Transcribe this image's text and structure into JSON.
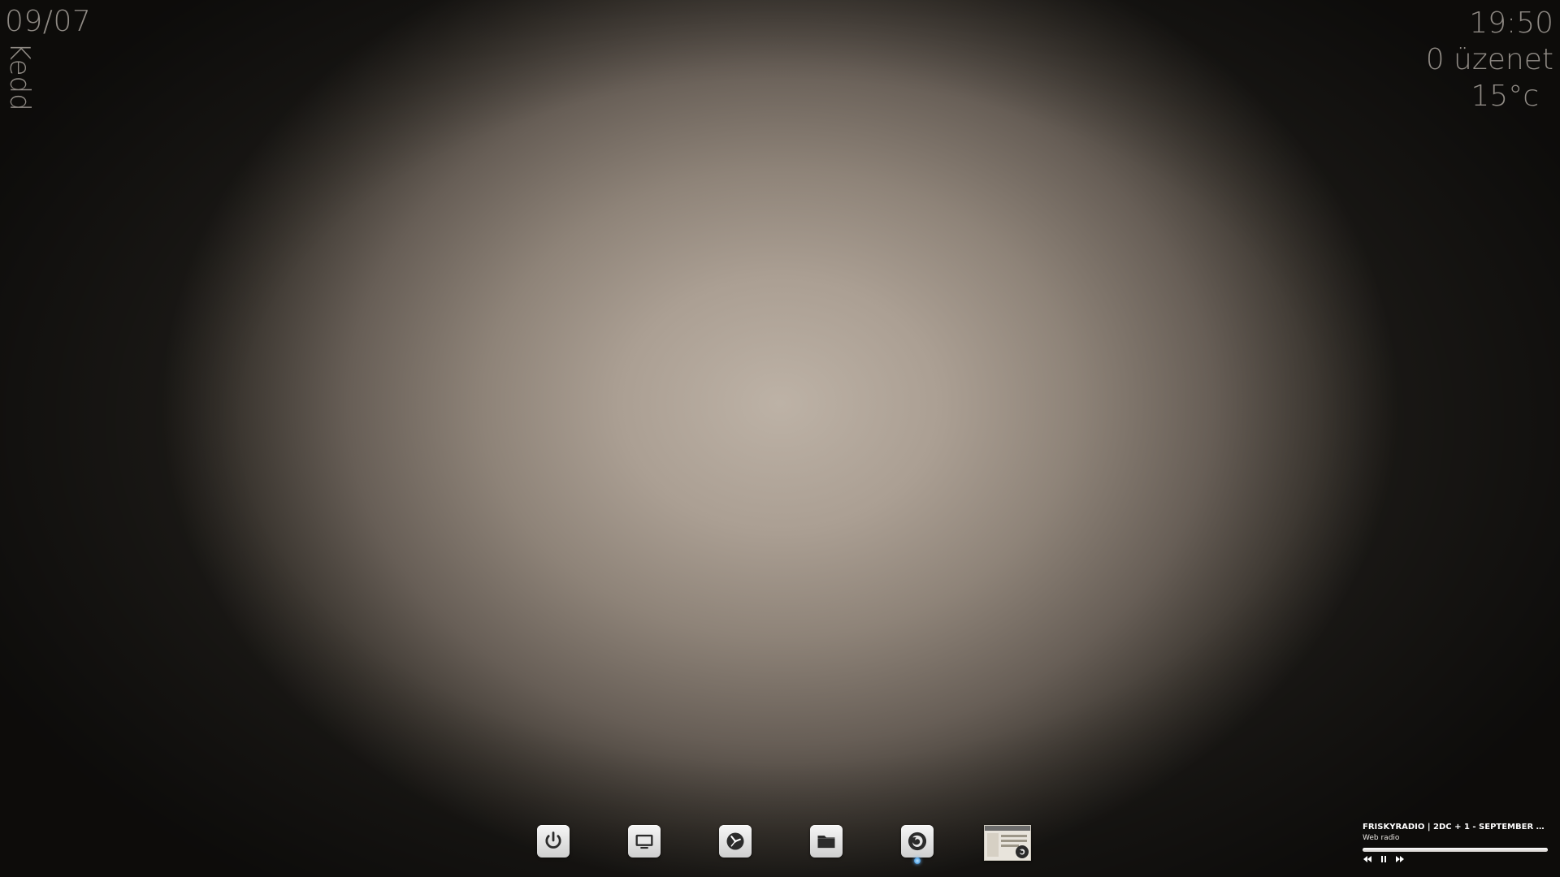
{
  "date_widget": {
    "date": "09/07",
    "day": "Kedd"
  },
  "info_widget": {
    "time": "19:50",
    "messages": "0 üzenet",
    "temperature": "15°c"
  },
  "dock": {
    "items": [
      {
        "icon": "power-icon"
      },
      {
        "icon": "monitor-icon"
      },
      {
        "icon": "clock-icon"
      },
      {
        "icon": "folder-icon"
      },
      {
        "icon": "firefox-icon",
        "running": true
      },
      {
        "icon": "window-thumbnail"
      }
    ]
  },
  "media": {
    "title": "FRISKYRADIO | 2DC + 1 - SEPTEMBER 2...",
    "subtitle": "Web radio",
    "progress": 1.0,
    "controls": [
      "previous-icon",
      "pause-icon",
      "next-icon"
    ]
  },
  "colors": {
    "widget_text": "#8f8a84",
    "media_text": "#ffffff",
    "running_indicator": "#5aa9e8"
  }
}
